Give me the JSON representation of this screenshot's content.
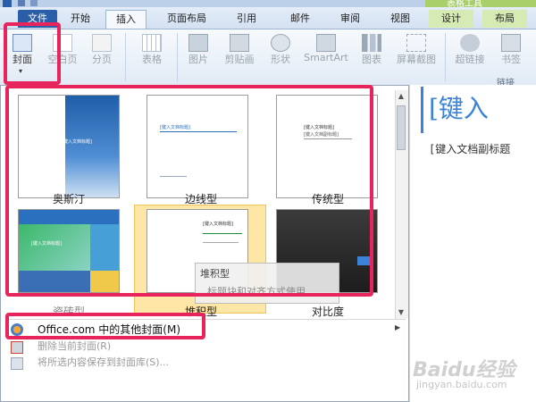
{
  "tabs": [
    "文件",
    "开始",
    "插入",
    "页面布局",
    "引用",
    "邮件",
    "审阅",
    "视图",
    "设计",
    "布局"
  ],
  "contextual_tab_label": "表格工具",
  "ribbon": {
    "buttons": [
      {
        "label": "封面",
        "icon": "cover-page-icon"
      },
      {
        "label": "空白页",
        "icon": "blank-page-icon"
      },
      {
        "label": "分页",
        "icon": "page-break-icon"
      },
      {
        "label": "表格",
        "icon": "table-icon"
      },
      {
        "label": "图片",
        "icon": "picture-icon"
      },
      {
        "label": "剪贴画",
        "icon": "clipart-icon"
      },
      {
        "label": "形状",
        "icon": "shapes-icon"
      },
      {
        "label": "SmartArt",
        "icon": "smartart-icon"
      },
      {
        "label": "图表",
        "icon": "chart-icon"
      },
      {
        "label": "屏幕截图",
        "icon": "screenshot-icon"
      },
      {
        "label": "超链接",
        "icon": "hyperlink-icon"
      },
      {
        "label": "书签",
        "icon": "bookmark-icon"
      }
    ],
    "group_label": "链接"
  },
  "gallery": {
    "items": [
      "奥斯汀",
      "边线型",
      "传统型",
      "瓷砖型",
      "堆积型",
      "对比度"
    ],
    "tooltip_title": "堆积型",
    "tooltip_desc": "标题块和对齐方式使用"
  },
  "menu": {
    "more": "Office.com 中的其他封面(M)",
    "remove": "删除当前封面(R)",
    "save": "将所选内容保存到封面库(S)..."
  },
  "document": {
    "title": "[键入",
    "subtitle": "[键入文档副标题"
  },
  "thumb_texts": {
    "austin_title": "[键入文档标题]",
    "sideline_title": "[键入文档标题]",
    "traditional_title": "[键入文档标题]",
    "traditional_sub": "[键入文档副标题]",
    "tiles_title": "[键入文档标题]",
    "stack_title": "[键入文档标题]"
  },
  "watermark": {
    "brand": "Baidu经验",
    "url": "jingyan.baidu.com"
  },
  "colors": {
    "accent": "#2a5ea8",
    "highlight": "#e8245c",
    "hover": "#fde6a6",
    "doc_blue": "#3b83d6"
  }
}
